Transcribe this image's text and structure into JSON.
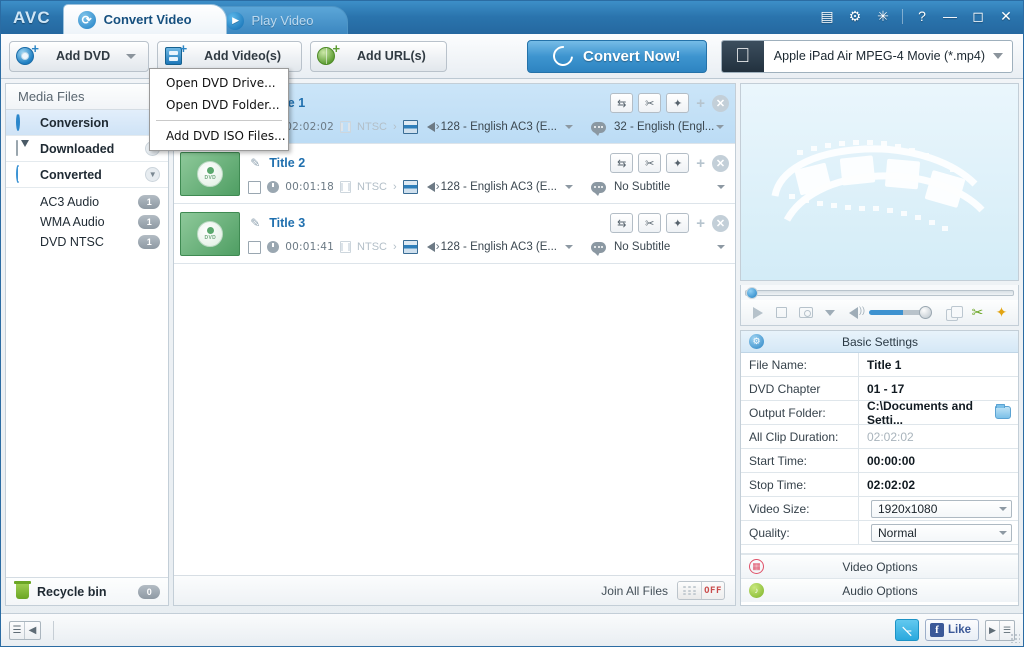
{
  "window": {
    "logo": "AVC",
    "tabs": [
      {
        "label": "Convert Video",
        "icon": "convert-icon",
        "active": true
      },
      {
        "label": "Play Video",
        "icon": "play-icon",
        "active": false
      }
    ],
    "controls": [
      {
        "name": "list-view-icon",
        "glyph": "▤"
      },
      {
        "name": "settings-gear-icon",
        "glyph": "✿"
      },
      {
        "name": "search-key-icon",
        "glyph": "✎"
      },
      {
        "name": "help-icon",
        "glyph": "?"
      },
      {
        "name": "minimize-button",
        "glyph": "—"
      },
      {
        "name": "maximize-button",
        "glyph": "❐"
      },
      {
        "name": "close-button",
        "glyph": "✕"
      }
    ]
  },
  "toolbar": {
    "add_dvd": "Add DVD",
    "add_videos": "Add Video(s)",
    "add_urls": "Add URL(s)",
    "convert_now": "Convert Now!",
    "profile": "Apple iPad Air MPEG-4 Movie (*.mp4)"
  },
  "dvd_menu": {
    "items": [
      "Open DVD Drive...",
      "Open DVD Folder...",
      "Add DVD ISO Files..."
    ]
  },
  "sidebar": {
    "header": "Media Files",
    "items": [
      {
        "label": "Conversion",
        "icon": "conversion-icon",
        "selected": true,
        "chevron": false,
        "count": null
      },
      {
        "label": "Downloaded",
        "icon": "download-icon",
        "selected": false,
        "chevron": true,
        "count": null
      },
      {
        "label": "Converted",
        "icon": "converted-icon",
        "selected": false,
        "chevron": true,
        "count": null
      }
    ],
    "children": [
      {
        "label": "AC3 Audio",
        "count": "1"
      },
      {
        "label": "WMA Audio",
        "count": "1"
      },
      {
        "label": "DVD NTSC",
        "count": "1"
      }
    ],
    "recycle_bin": {
      "label": "Recycle bin",
      "count": "0"
    }
  },
  "filelist": {
    "rows": [
      {
        "title": "Title 1",
        "duration": "02:02:02",
        "format": "NTSC",
        "audio": "128 - English AC3 (E...",
        "subtitle": "32 - English (Engl...",
        "selected": true,
        "has_thumb": false,
        "has_checkbox": false
      },
      {
        "title": "Title 2",
        "duration": "00:01:18",
        "format": "NTSC",
        "audio": "128 - English AC3 (E...",
        "subtitle": "No Subtitle",
        "selected": false,
        "has_thumb": true,
        "has_checkbox": true
      },
      {
        "title": "Title 3",
        "duration": "00:01:41",
        "format": "NTSC",
        "audio": "128 - English AC3 (E...",
        "subtitle": "No Subtitle",
        "selected": false,
        "has_thumb": true,
        "has_checkbox": true
      }
    ],
    "row_actions": [
      {
        "name": "convert-row-icon",
        "glyph": "⇄"
      },
      {
        "name": "cut-row-icon",
        "glyph": "✄"
      },
      {
        "name": "effect-wand-icon",
        "glyph": "🪄"
      }
    ],
    "footer": {
      "join_label": "Join All Files",
      "toggle_state": "OFF"
    }
  },
  "preview": {
    "placeholder_icon": "film-strip-watermark",
    "controls": [
      {
        "name": "play-button",
        "glyph": "▷"
      },
      {
        "name": "stop-button",
        "glyph": "■"
      },
      {
        "name": "snapshot-camera-button",
        "glyph": "▣"
      },
      {
        "name": "snapshot-menu-caret",
        "glyph": "▾"
      },
      {
        "name": "volume-speaker-icon",
        "glyph": "🔊"
      },
      {
        "name": "volume-slider",
        "glyph": ""
      },
      {
        "name": "window-stack-button",
        "glyph": "❐"
      },
      {
        "name": "trim-scissors-button",
        "glyph": "✄"
      },
      {
        "name": "effects-wand-button",
        "glyph": "🪄"
      }
    ]
  },
  "settings": {
    "title": "Basic Settings",
    "rows": [
      {
        "label": "File Name:",
        "value": "Title 1",
        "type": "text",
        "muted": false
      },
      {
        "label": "DVD Chapter",
        "value": "01 - 17",
        "type": "text",
        "muted": false
      },
      {
        "label": "Output Folder:",
        "value": "C:\\Documents and Setti...",
        "type": "folder",
        "muted": false
      },
      {
        "label": "All Clip Duration:",
        "value": "02:02:02",
        "type": "text",
        "muted": true
      },
      {
        "label": "Start Time:",
        "value": "00:00:00",
        "type": "text",
        "muted": false
      },
      {
        "label": "Stop Time:",
        "value": "02:02:02",
        "type": "text",
        "muted": false
      },
      {
        "label": "Video Size:",
        "value": "1920x1080",
        "type": "combo",
        "muted": false
      },
      {
        "label": "Quality:",
        "value": "Normal",
        "type": "combo",
        "muted": false
      }
    ],
    "video_options": "Video Options",
    "audio_options": "Audio Options"
  },
  "statusbar": {
    "facebook_like": "Like"
  },
  "colors": {
    "titlebar": "#2a74ad",
    "accent_blue": "#3d94cf",
    "selected_row": "#c3e0f6",
    "link_blue": "#1f6fae",
    "green": "#6aa524",
    "red": "#e0536a",
    "toggle_off": "#c94b4b"
  }
}
